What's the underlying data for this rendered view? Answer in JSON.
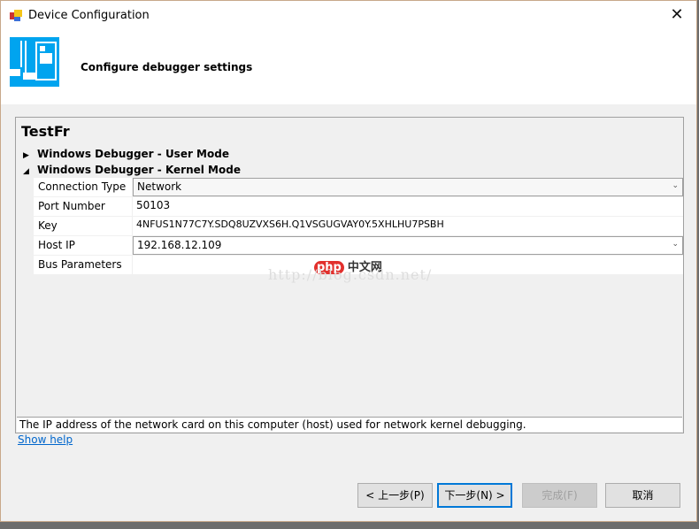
{
  "window": {
    "title": "Device Configuration",
    "close": "✕"
  },
  "header": {
    "title": "Configure debugger settings"
  },
  "panel": {
    "title": "TestFr",
    "tree": [
      {
        "label": "Windows Debugger - User Mode",
        "expanded": false,
        "arrow": "▶"
      },
      {
        "label": "Windows Debugger - Kernel Mode",
        "expanded": true,
        "arrow": "◢"
      }
    ],
    "properties": [
      {
        "label": "Connection Type",
        "value": "Network",
        "dropdown": true
      },
      {
        "label": "Port Number",
        "value": "50103"
      },
      {
        "label": "Key",
        "value": "4NFUS1N77C7Y.SDQ8UZVXS6H.Q1VSGUGVAY0Y.5XHLHU7PSBH"
      },
      {
        "label": "Host IP",
        "value": "192.168.12.109",
        "dropdown": true
      },
      {
        "label": "Bus Parameters",
        "value": ""
      }
    ],
    "description": "The IP address of the network card on this computer (host) used for network kernel debugging."
  },
  "show_help": "Show help",
  "buttons": {
    "back": "< 上一步(P)",
    "next": "下一步(N) >",
    "finish": "完成(F)",
    "cancel": "取消"
  },
  "watermark": {
    "url": "http://blog.csdn.net/",
    "logo_php": "php",
    "logo_cn": "中文网"
  },
  "dropdown_glyph": "⌄"
}
